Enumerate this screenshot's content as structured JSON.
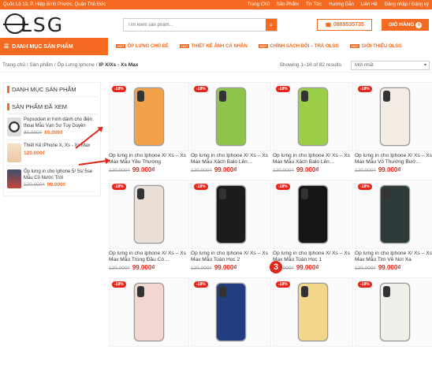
{
  "topbar": {
    "address": "Quốc Lộ 13, P. Hiệp Bình Phước, Quận Thủ Đức",
    "links": [
      "Trang Chủ",
      "Sản Phẩm",
      "Tin Tức",
      "Hướng Dẫn",
      "Liên Hệ",
      "Đăng nhập / Đăng ký"
    ]
  },
  "logo": "LSG",
  "search": {
    "placeholder": "Tìm kiếm sản phẩm..."
  },
  "phone": "0889535735",
  "cart": {
    "label": "GIỎ HÀNG",
    "count": "0"
  },
  "nav": {
    "category_button": "DANH MỤC SẢN PHẨM",
    "items": [
      "ỐP LƯNG CHỦ ĐỀ",
      "THIẾT KẾ ẢNH CÁ NHÂN",
      "CHÍNH SÁCH ĐỔI – TRẢ OLSG",
      "GIỚI THIỆU OLSG"
    ],
    "tag": "HOT"
  },
  "breadcrumb": {
    "items": [
      "Trang chủ",
      "Sản phẩm",
      "Ốp Lưng Iphone"
    ],
    "current": "IP X/Xs - Xs Max"
  },
  "showing": "Showing 1–16 of 82 results",
  "sort": "Mới nhất",
  "sidebar": {
    "category_title": "DANH MỤC SẢN PHẨM",
    "viewed_title": "SẢN PHẨM ĐÃ XEM",
    "viewed": [
      {
        "name": "Popsocket in hình dành cho điện thoại Mẫu Vạn Sự Tuỳ Duyên",
        "old": "80.000₫",
        "price": "65.000₫"
      },
      {
        "name": "Thiết Kế IPhone X, Xs - Xs Max",
        "old": "",
        "price": "120.000₫"
      },
      {
        "name": "Ốp lưng in cho Iphone 5/ 5s/ 5se Mẫu Cỏ Nước Trời",
        "old": "120.000₫",
        "price": "99.000₫"
      }
    ]
  },
  "products": [
    {
      "badge": "-18%",
      "name": "Ốp lưng in cho Iphone X/ Xs – Xs Max Mẫu Yêu Thương",
      "old": "120.000₫",
      "price": "99.000₫",
      "color": "#f4a24a"
    },
    {
      "badge": "-18%",
      "name": "Ốp lưng in cho Iphone X/ Xs – Xs Max Mẫu Xách Balo Lên…",
      "old": "120.000₫",
      "price": "99.000₫",
      "color": "#8fc44a"
    },
    {
      "badge": "-18%",
      "name": "Ốp lưng in cho Iphone X/ Xs – Xs Max Mẫu Xách Balo Lên…",
      "old": "120.000₫",
      "price": "99.000₫",
      "color": "#9ccf48"
    },
    {
      "badge": "-18%",
      "name": "Ốp lưng in cho Iphone X/ Xs – Xs Max Mẫu Vô Thường Bướ…",
      "old": "120.000₫",
      "price": "99.000₫",
      "color": "#f2ece4"
    },
    {
      "badge": "-18%",
      "name": "Ốp lưng in cho Iphone X/ Xs – Xs Max Mẫu Trong Đầu Có…",
      "old": "120.000₫",
      "price": "99.000₫",
      "color": "#eadfd6"
    },
    {
      "badge": "-18%",
      "name": "Ốp lưng in cho Iphone X/ Xs – Xs Max Mẫu Toán Học 2",
      "old": "120.000₫",
      "price": "99.000₫",
      "color": "#1c1c1c"
    },
    {
      "badge": "-18%",
      "name": "Ốp lưng in cho Iphone X/ Xs – Xs Max Mẫu Toán Học 1",
      "old": "120.000₫",
      "price": "99.000₫",
      "color": "#161616"
    },
    {
      "badge": "-18%",
      "name": "Ốp lưng in cho Iphone X/ Xs – Xs Max Mẫu Tim Về Nơi Xa",
      "old": "120.000₫",
      "price": "99.000₫",
      "color": "#2d3c3a"
    },
    {
      "badge": "-18%",
      "name": "",
      "old": "",
      "price": "",
      "color": "#f1d7cf"
    },
    {
      "badge": "-18%",
      "name": "",
      "old": "",
      "price": "",
      "color": "#233e80"
    },
    {
      "badge": "-18%",
      "name": "",
      "old": "",
      "price": "",
      "color": "#f4d58c"
    },
    {
      "badge": "-18%",
      "name": "",
      "old": "",
      "price": "",
      "color": "#eef0ea"
    }
  ],
  "annotation_number": "3"
}
